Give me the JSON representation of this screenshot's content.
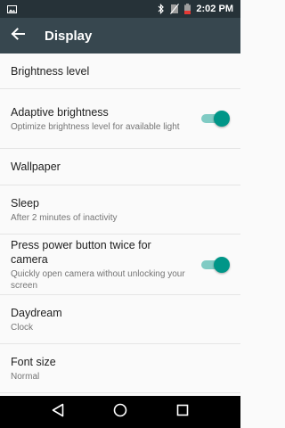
{
  "status_bar": {
    "time": "2:02",
    "ampm": "PM",
    "icons": [
      "photo-notification-icon",
      "bluetooth-icon",
      "no-sim-icon",
      "battery-icon"
    ]
  },
  "app_bar": {
    "title": "Display",
    "back_icon": "arrow-back-icon"
  },
  "settings": {
    "brightness_level": {
      "title": "Brightness level"
    },
    "adaptive_brightness": {
      "title": "Adaptive brightness",
      "summary": "Optimize brightness level for available light",
      "enabled": true
    },
    "wallpaper": {
      "title": "Wallpaper"
    },
    "sleep": {
      "title": "Sleep",
      "summary": "After 2 minutes of inactivity"
    },
    "power_double_tap": {
      "title": "Press power button twice for camera",
      "summary": "Quickly open camera without unlocking your screen",
      "enabled": true
    },
    "daydream": {
      "title": "Daydream",
      "summary": "Clock"
    },
    "font_size": {
      "title": "Font size",
      "summary": "Normal"
    }
  },
  "nav_bar": {
    "icons": [
      "back-triangle-icon",
      "home-circle-icon",
      "recents-square-icon"
    ]
  },
  "colors": {
    "status_bar": "#263238",
    "app_bar": "#37474f",
    "accent": "#009688"
  }
}
